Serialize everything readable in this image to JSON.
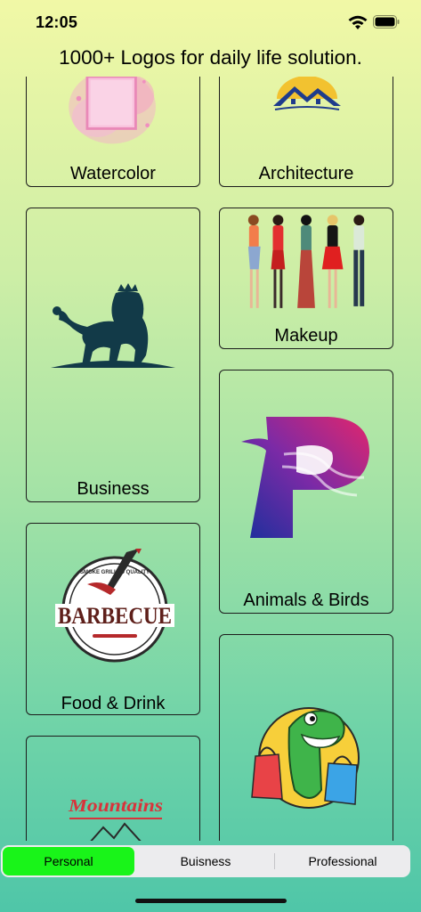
{
  "status_bar": {
    "time": "12:05",
    "icons": [
      "wifi-icon",
      "battery-icon"
    ]
  },
  "header": {
    "title": "1000+ Logos for daily life solution."
  },
  "categories": {
    "left": [
      {
        "label": "Watercolor",
        "image": "watercolor-square-image"
      },
      {
        "label": "Business",
        "image": "lion-logo-image"
      },
      {
        "label": "Food & Drink",
        "image": "barbecue-badge-image"
      },
      {
        "label": "",
        "image": "mountains-logo-image"
      }
    ],
    "right": [
      {
        "label": "Architecture",
        "image": "house-roof-logo-image"
      },
      {
        "label": "Makeup",
        "image": "fashion-women-image"
      },
      {
        "label": "Animals & Birds",
        "image": "phoenix-p-logo-image"
      },
      {
        "label": "",
        "image": "dinosaur-shopping-image"
      }
    ]
  },
  "artwork_text": {
    "barbecue": "BARBECUE",
    "barbecue_ring": "SMOKE GRILLED QUALITY",
    "mountains": "Mountains"
  },
  "segmented_control": {
    "segments": [
      "Personal",
      "Buisness",
      "Professional"
    ],
    "selected": "Personal",
    "active_color": "#19f419"
  },
  "colors": {
    "gradient_top": "#f1f8a6",
    "gradient_bottom": "#4fc6a8",
    "card_border": "#1c1c1c"
  }
}
